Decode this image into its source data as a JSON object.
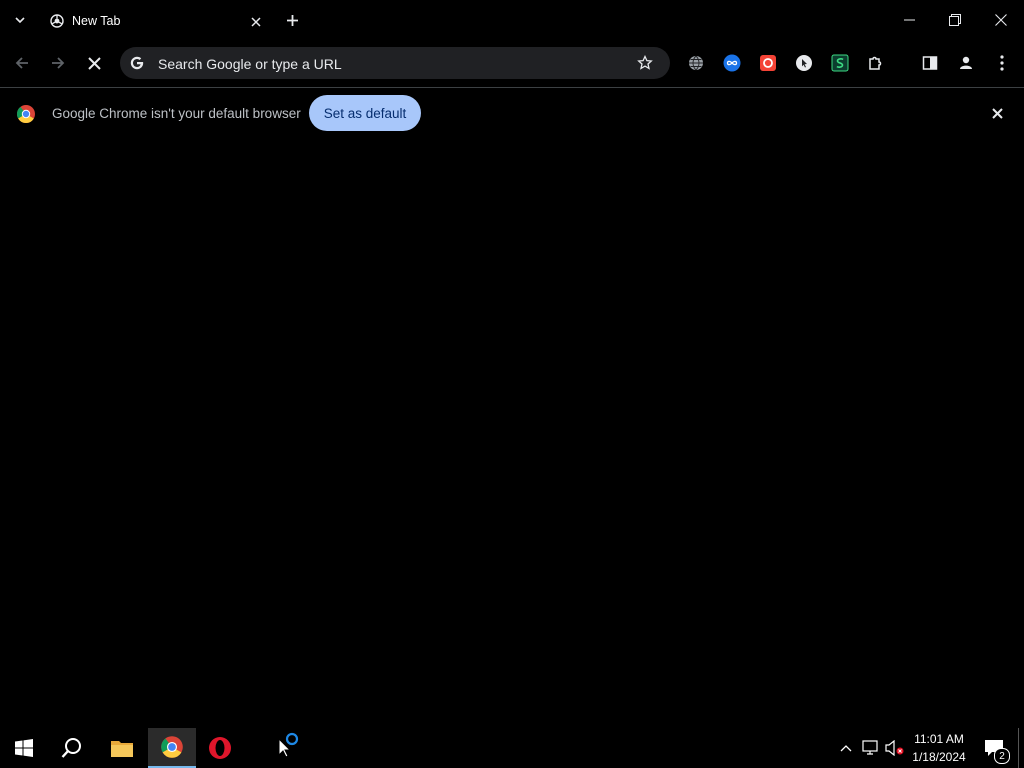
{
  "tab": {
    "title": "New Tab"
  },
  "omnibox": {
    "placeholder": "Search Google or type a URL"
  },
  "infobar": {
    "message": "Google Chrome isn't your default browser",
    "button_label": "Set as default"
  },
  "taskbar": {
    "time": "11:01 AM",
    "date": "1/18/2024",
    "notification_count": "2"
  },
  "colors": {
    "accent_button": "#a8c7fa",
    "omnibox_bg": "#202124"
  },
  "icons": [
    "tab-search-icon",
    "chrome-new-tab-icon",
    "close-tab-icon",
    "new-tab-icon",
    "minimize-icon",
    "restore-icon",
    "close-window-icon",
    "back-icon",
    "forward-icon",
    "stop-loading-icon",
    "google-g-icon",
    "bookmark-star-icon",
    "globe-extension-icon",
    "infinity-extension-icon",
    "red-extension-icon",
    "cursor-extension-icon",
    "s-extension-icon",
    "puzzle-extensions-icon",
    "side-panel-icon",
    "profile-icon",
    "kebab-menu-icon",
    "chrome-logo-icon",
    "windows-start-icon",
    "search-icon",
    "file-explorer-icon",
    "chrome-taskbar-icon",
    "opera-icon",
    "loading-cursor-icon",
    "chevron-up-icon",
    "network-icon",
    "volume-muted-icon",
    "notifications-icon"
  ]
}
